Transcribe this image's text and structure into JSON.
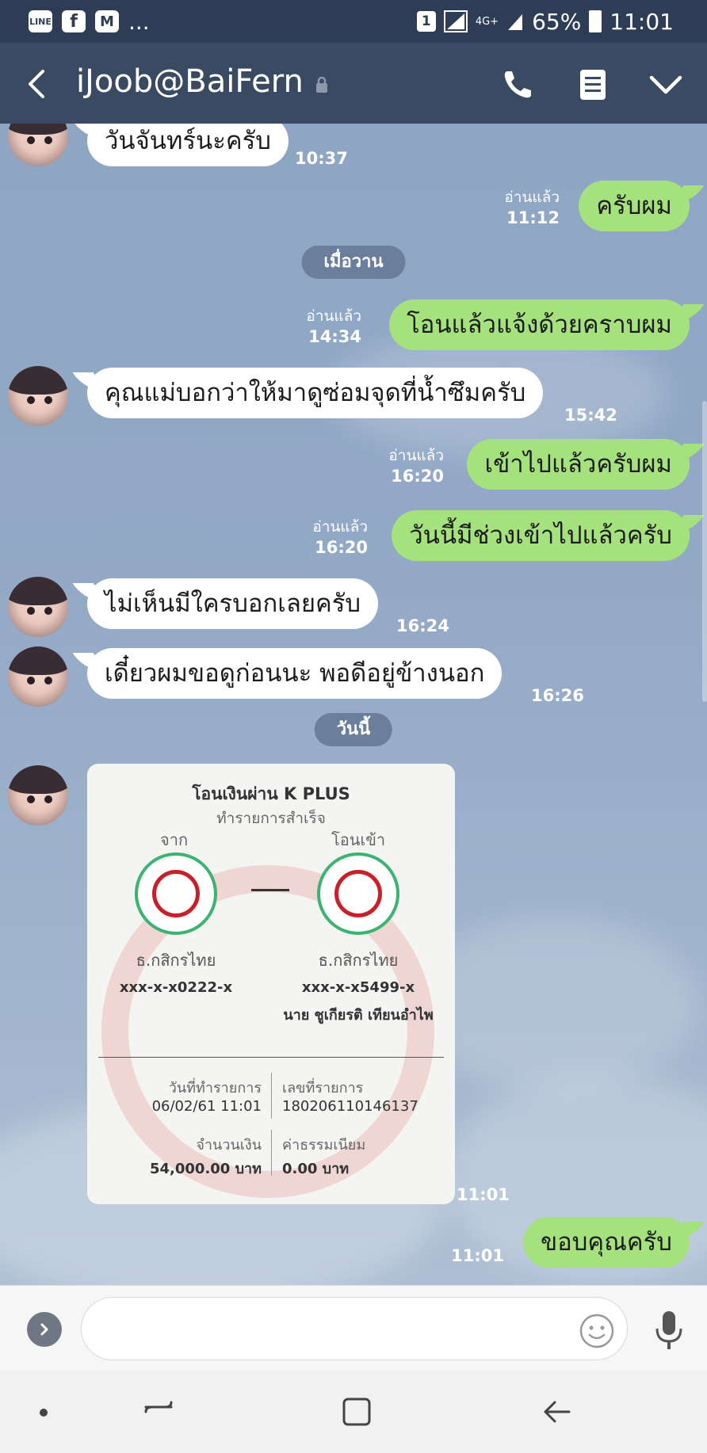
{
  "status_bar": {
    "left_icons": [
      "line-icon",
      "facebook-icon",
      "gmail-icon"
    ],
    "ellipsis": "...",
    "sim_slot": "1",
    "network": "4G+",
    "battery": "65%",
    "time": "11:01"
  },
  "header": {
    "title": "iJoob@BaiFern"
  },
  "chat": {
    "messages": [
      {
        "side": "in",
        "text": "วันจันทร์นะครับ",
        "time": "10:37"
      },
      {
        "side": "out",
        "text": "ครับผม",
        "read": "อ่านแล้ว",
        "time": "11:12"
      },
      {
        "side": "out",
        "text": "โอนแล้วแจ้งด้วยคราบผม",
        "read": "อ่านแล้ว",
        "time": "14:34"
      },
      {
        "side": "in",
        "text": "คุณแม่บอกว่าให้มาดูซ่อมจุดที่น้ำซึมครับ",
        "time": "15:42"
      },
      {
        "side": "out",
        "text": "เข้าไปแล้วครับผม",
        "read": "อ่านแล้ว",
        "time": "16:20"
      },
      {
        "side": "out",
        "text": "วันนี้มีช่วงเข้าไปแล้วครับ",
        "read": "อ่านแล้ว",
        "time": "16:20"
      },
      {
        "side": "in",
        "text": "ไม่เห็นมีใครบอกเลยครับ",
        "time": "16:24"
      },
      {
        "side": "in",
        "text": "เดี๋ยวผมขอดูก่อนนะ พอดีอยู่ข้างนอก",
        "time": "16:26"
      },
      {
        "side": "in",
        "type": "image",
        "time": "11:01"
      },
      {
        "side": "out",
        "text": "ขอบคุณครับ",
        "time": "11:01"
      }
    ],
    "date_separators": [
      "เมื่อวาน",
      "วันนี้"
    ]
  },
  "receipt": {
    "title": "โอนเงินผ่าน K PLUS",
    "subtitle": "ทำรายการสำเร็จ",
    "from_label": "จาก",
    "to_label": "โอนเข้า",
    "from_bank": "ธ.กสิกรไทย",
    "to_bank": "ธ.กสิกรไทย",
    "from_account": "xxx-x-x0222-x",
    "to_account": "xxx-x-x5499-x",
    "to_name": "นาย ชูเกียรติ เทียนอำไพ",
    "date_label": "วันที่ทำรายการ",
    "date_value": "06/02/61 11:01",
    "ref_label": "เลขที่รายการ",
    "ref_value": "180206110146137",
    "amount_label": "จำนวนเงิน",
    "amount_value": "54,000.00 บาท",
    "fee_label": "ค่าธรรมเนียม",
    "fee_value": "0.00 บาท",
    "colors": {
      "kbank_green": "#3cb371",
      "kbank_red": "#c8202a"
    }
  },
  "input_bar": {
    "placeholder": ""
  },
  "colors": {
    "outgoing_bubble": "#a5e27e",
    "incoming_bubble": "#ffffff",
    "header": "#3b4a63",
    "chat_bg": "#8ea6c4"
  }
}
